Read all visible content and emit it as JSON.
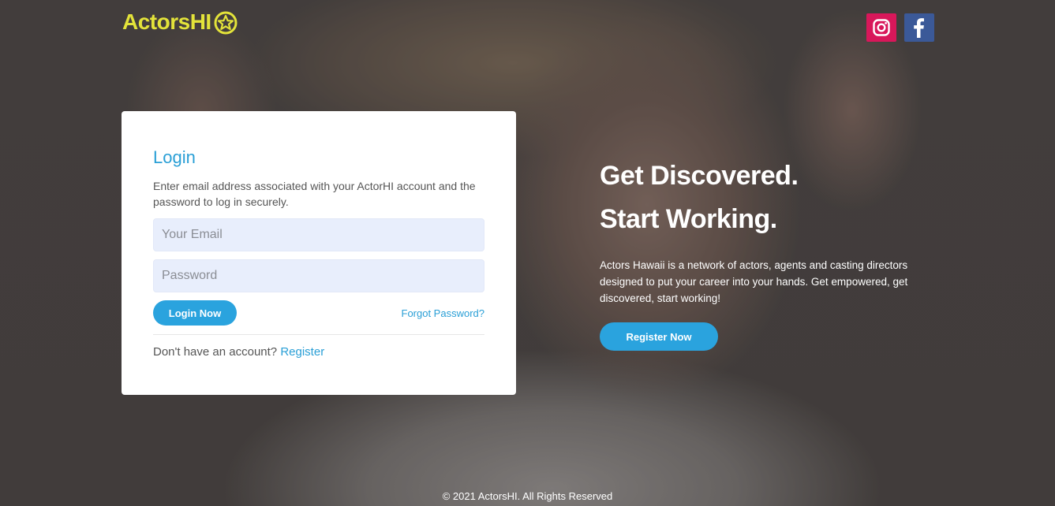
{
  "brand": {
    "name": "ActorsHI",
    "logo_text": "ActorsHI",
    "color": "#e3e33a"
  },
  "social": [
    {
      "name": "instagram",
      "icon": "instagram-icon",
      "color": "#d8175a"
    },
    {
      "name": "facebook",
      "icon": "facebook-icon",
      "color": "#3b5998"
    }
  ],
  "login": {
    "title": "Login",
    "description": "Enter email address associated with your ActorHI account and the password to log in securely.",
    "email_placeholder": "Your Email",
    "email_value": "",
    "password_placeholder": "Password",
    "password_value": "",
    "submit_label": "Login Now",
    "forgot_label": "Forgot Password?",
    "no_account_text": "Don't have an account?",
    "register_link": "Register"
  },
  "hero": {
    "heading": "Get Discovered. Start Working.",
    "body": "Actors Hawaii is a network of actors, agents and casting directors designed to put your career into your hands. Get empowered, get discovered, start working!",
    "cta_label": "Register Now"
  },
  "footer": {
    "copyright": "© 2021 ActorsHI. All Rights Reserved"
  },
  "colors": {
    "accent": "#2aa3de",
    "link": "#2a9fd6",
    "input_bg": "#e8eefc"
  }
}
